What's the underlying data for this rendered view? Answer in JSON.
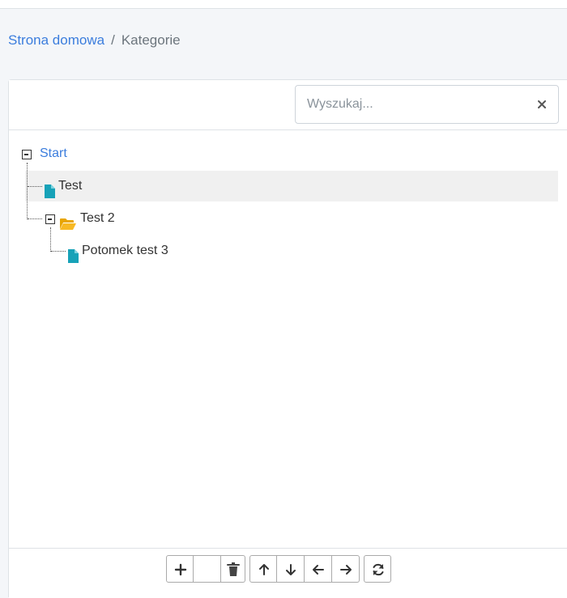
{
  "breadcrumb": {
    "home": "Strona domowa",
    "separator": "/",
    "current": "Kategorie"
  },
  "search": {
    "placeholder": "Wyszukaj...",
    "value": "",
    "clear_icon": "close-icon"
  },
  "tree": {
    "root": {
      "label": "Start",
      "expanded": true
    },
    "items": [
      {
        "label": "Test",
        "type": "file",
        "highlighted": true
      },
      {
        "label": "Test 2",
        "type": "folder",
        "expanded": true
      },
      {
        "label": "Potomek test 3",
        "type": "file"
      }
    ]
  },
  "toolbar": {
    "buttons": [
      {
        "name": "add",
        "icon": "plus-icon"
      },
      {
        "name": "blank",
        "icon": ""
      },
      {
        "name": "delete",
        "icon": "trash-icon"
      },
      {
        "name": "move-up",
        "icon": "arrow-up-icon"
      },
      {
        "name": "move-down",
        "icon": "arrow-down-icon"
      },
      {
        "name": "move-left",
        "icon": "arrow-left-icon"
      },
      {
        "name": "move-right",
        "icon": "arrow-right-icon"
      },
      {
        "name": "refresh",
        "icon": "refresh-icon"
      }
    ]
  },
  "colors": {
    "link": "#3b7ddd",
    "file_icon": "#17a2b8",
    "folder_icon": "#f5b400",
    "highlight_row": "#f0f0f0"
  }
}
